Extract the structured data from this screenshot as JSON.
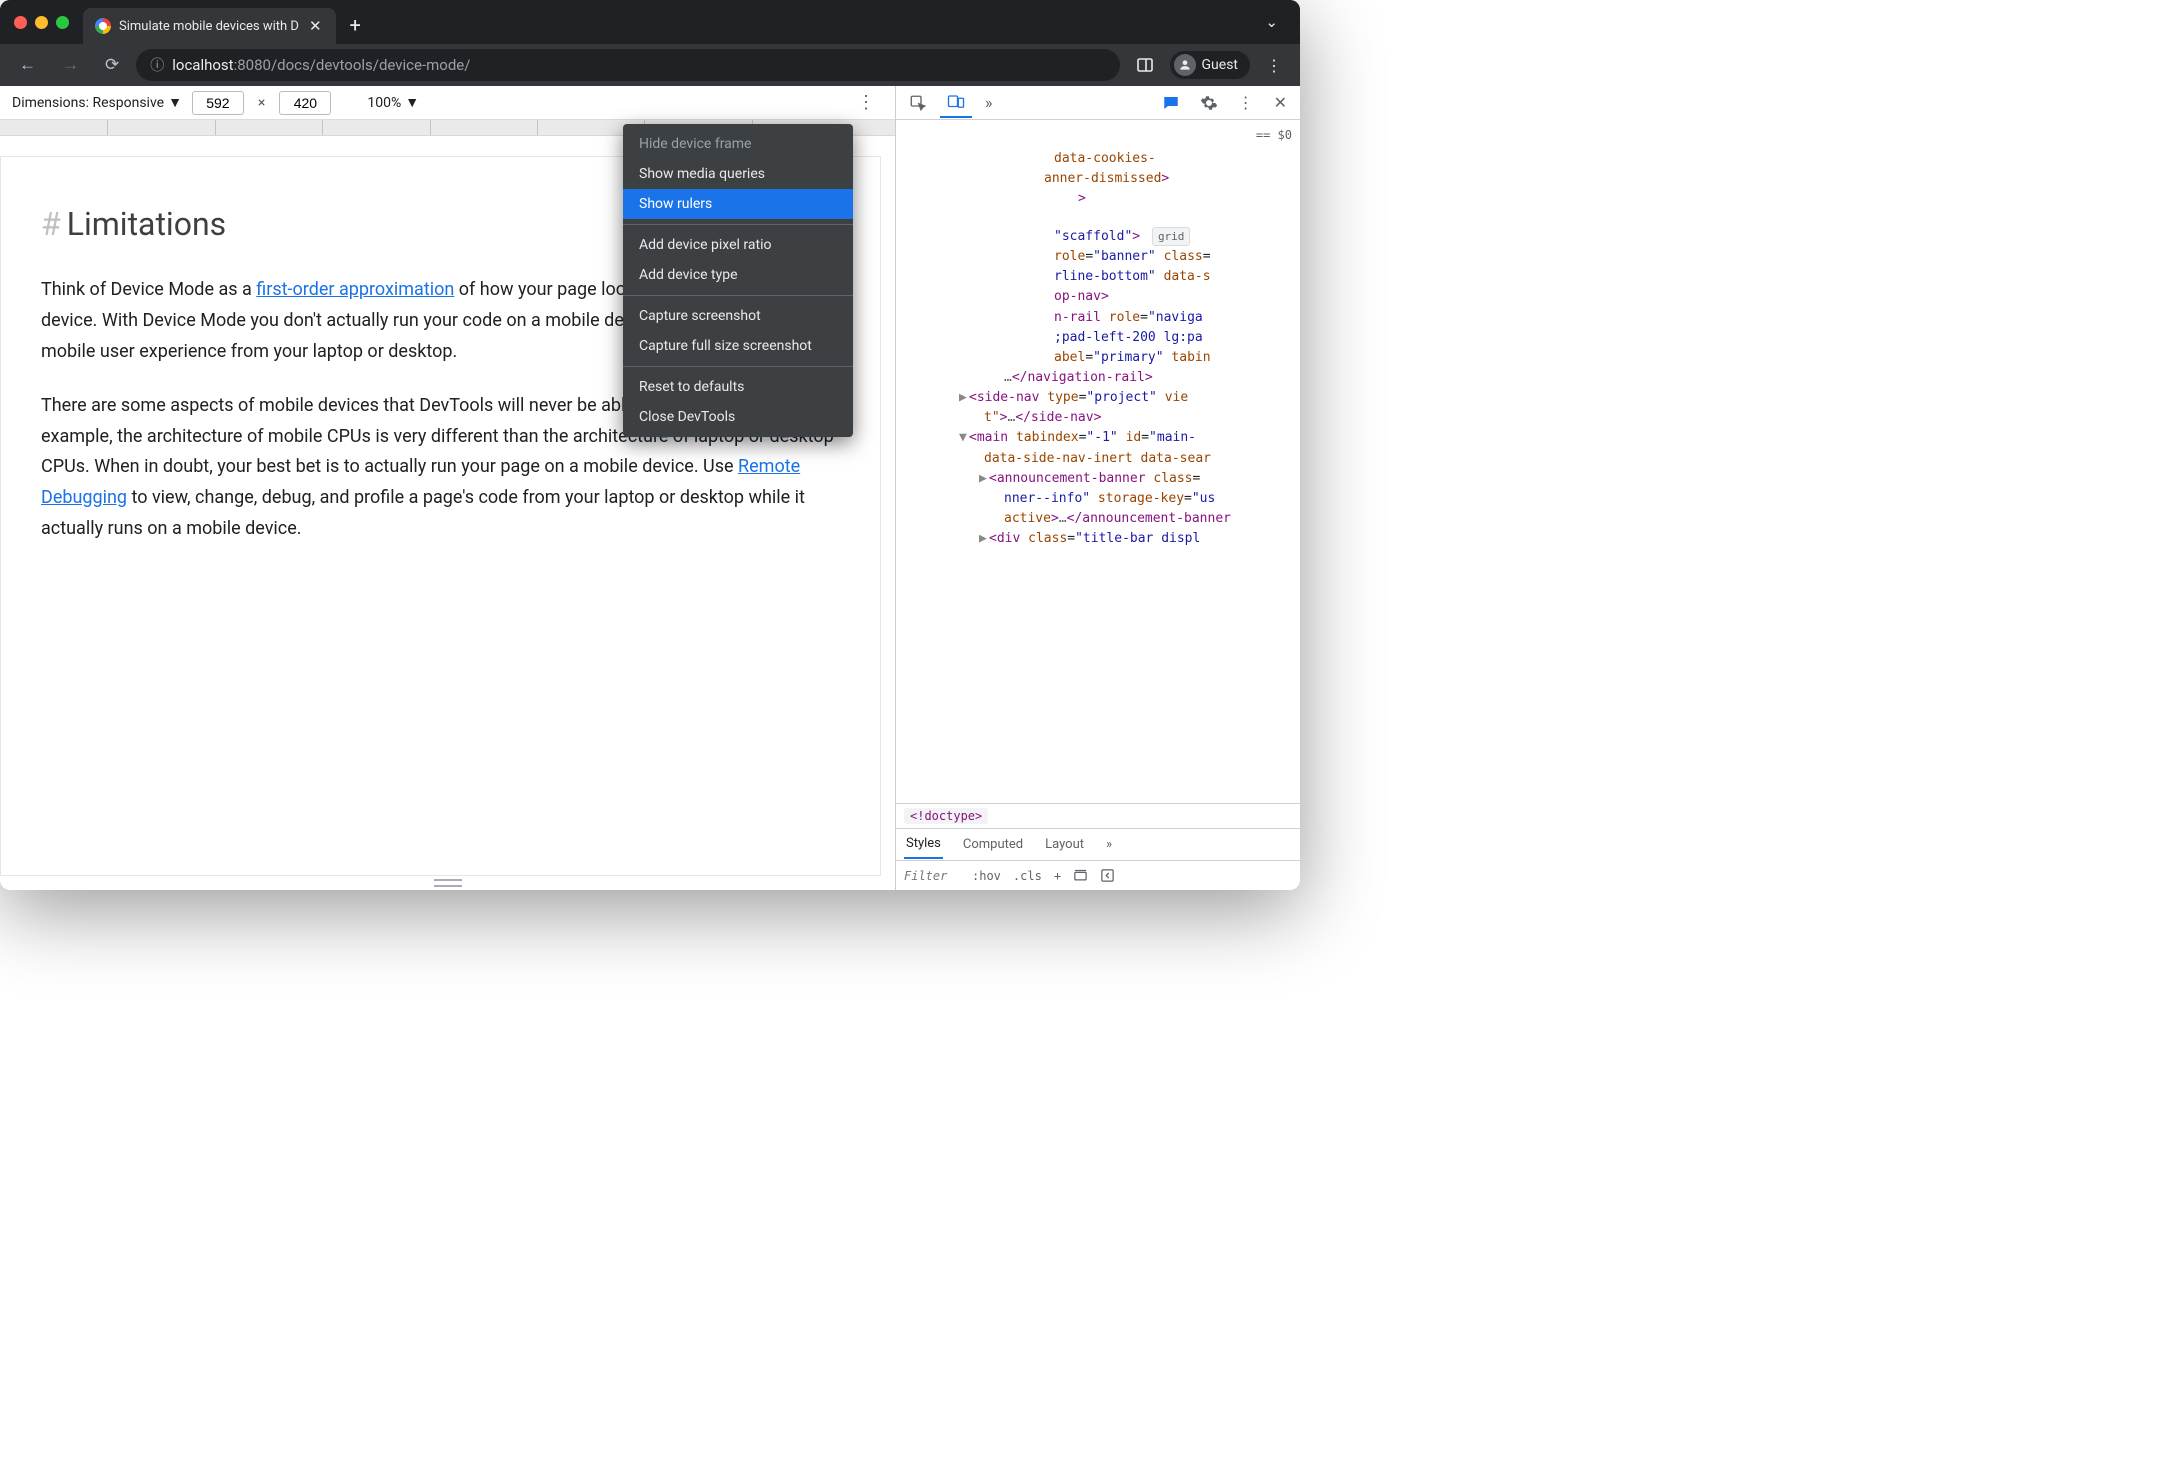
{
  "tab": {
    "title": "Simulate mobile devices with D"
  },
  "address": {
    "host": "localhost",
    "port": ":8080",
    "path": "/docs/devtools/device-mode/"
  },
  "profile": {
    "label": "Guest"
  },
  "device_toolbar": {
    "dimensions_label": "Dimensions: Responsive",
    "width": "592",
    "height": "420",
    "zoom": "100%"
  },
  "menu": {
    "hide_frame": "Hide device frame",
    "show_media_queries": "Show media queries",
    "show_rulers": "Show rulers",
    "add_dpr": "Add device pixel ratio",
    "add_device_type": "Add device type",
    "capture_screenshot": "Capture screenshot",
    "capture_full": "Capture full size screenshot",
    "reset": "Reset to defaults",
    "close_devtools": "Close DevTools"
  },
  "page": {
    "heading": "Limitations",
    "p1_a": "Think of Device Mode as a ",
    "p1_link": "first-order approximation",
    "p1_b": " of how your page looks and feels on a mobile device. With Device Mode you don't actually run your code on a mobile device. You simulate the mobile user experience from your laptop or desktop.",
    "p2_a": "There are some aspects of mobile devices that DevTools will never be able to simulate. For example, the architecture of mobile CPUs is very different than the architecture of laptop or desktop CPUs. When in doubt, your best bet is to actually run your page on a mobile device. Use ",
    "p2_link": "Remote Debugging",
    "p2_b": " to view, change, debug, and profile a page's code from your laptop or desktop while it actually runs on a mobile device."
  },
  "devtools": {
    "selected_ref": "== $0",
    "line1": "data-cookies-",
    "line1b": "anner-dismissed",
    "line2a": "\"scaffold\"",
    "grid_badge": "grid",
    "line3a": "role",
    "line3b": "\"banner\"",
    "line3c": "class",
    "line4": "rline-bottom\"",
    "line4b": "data-s",
    "line5": "op-nav",
    "line6a": "n-rail",
    "line6b": "role",
    "line6c": "\"naviga",
    "line7": ";pad-left-200 lg:pa",
    "line8a": "abel",
    "line8b": "\"primary\"",
    "line8c": "tabin",
    "line9a": "…",
    "line9b": "navigation-rail",
    "line10_tag": "side-nav",
    "line10a": "type",
    "line10b": "\"project\"",
    "line10c": "vie",
    "line10d": "t\"",
    "line11_tag": "main",
    "line11a": "tabindex",
    "line11b": "\"-1\"",
    "line11c": "id",
    "line11d": "\"main-",
    "line12": "data-side-nav-inert data-sear",
    "line13_tag": "announcement-banner",
    "line13a": "class",
    "line14a": "nner--info\"",
    "line14b": "storage-key",
    "line14c": "\"us",
    "line15a": "active",
    "line15b": "…",
    "line16_tag": "div",
    "line16a": "class",
    "line16b": "\"title-bar displ",
    "crumb": "!doctype",
    "styles_tab_styles": "Styles",
    "styles_tab_computed": "Computed",
    "styles_tab_layout": "Layout",
    "filter_placeholder": "Filter",
    "hov": ":hov",
    "cls": ".cls"
  }
}
